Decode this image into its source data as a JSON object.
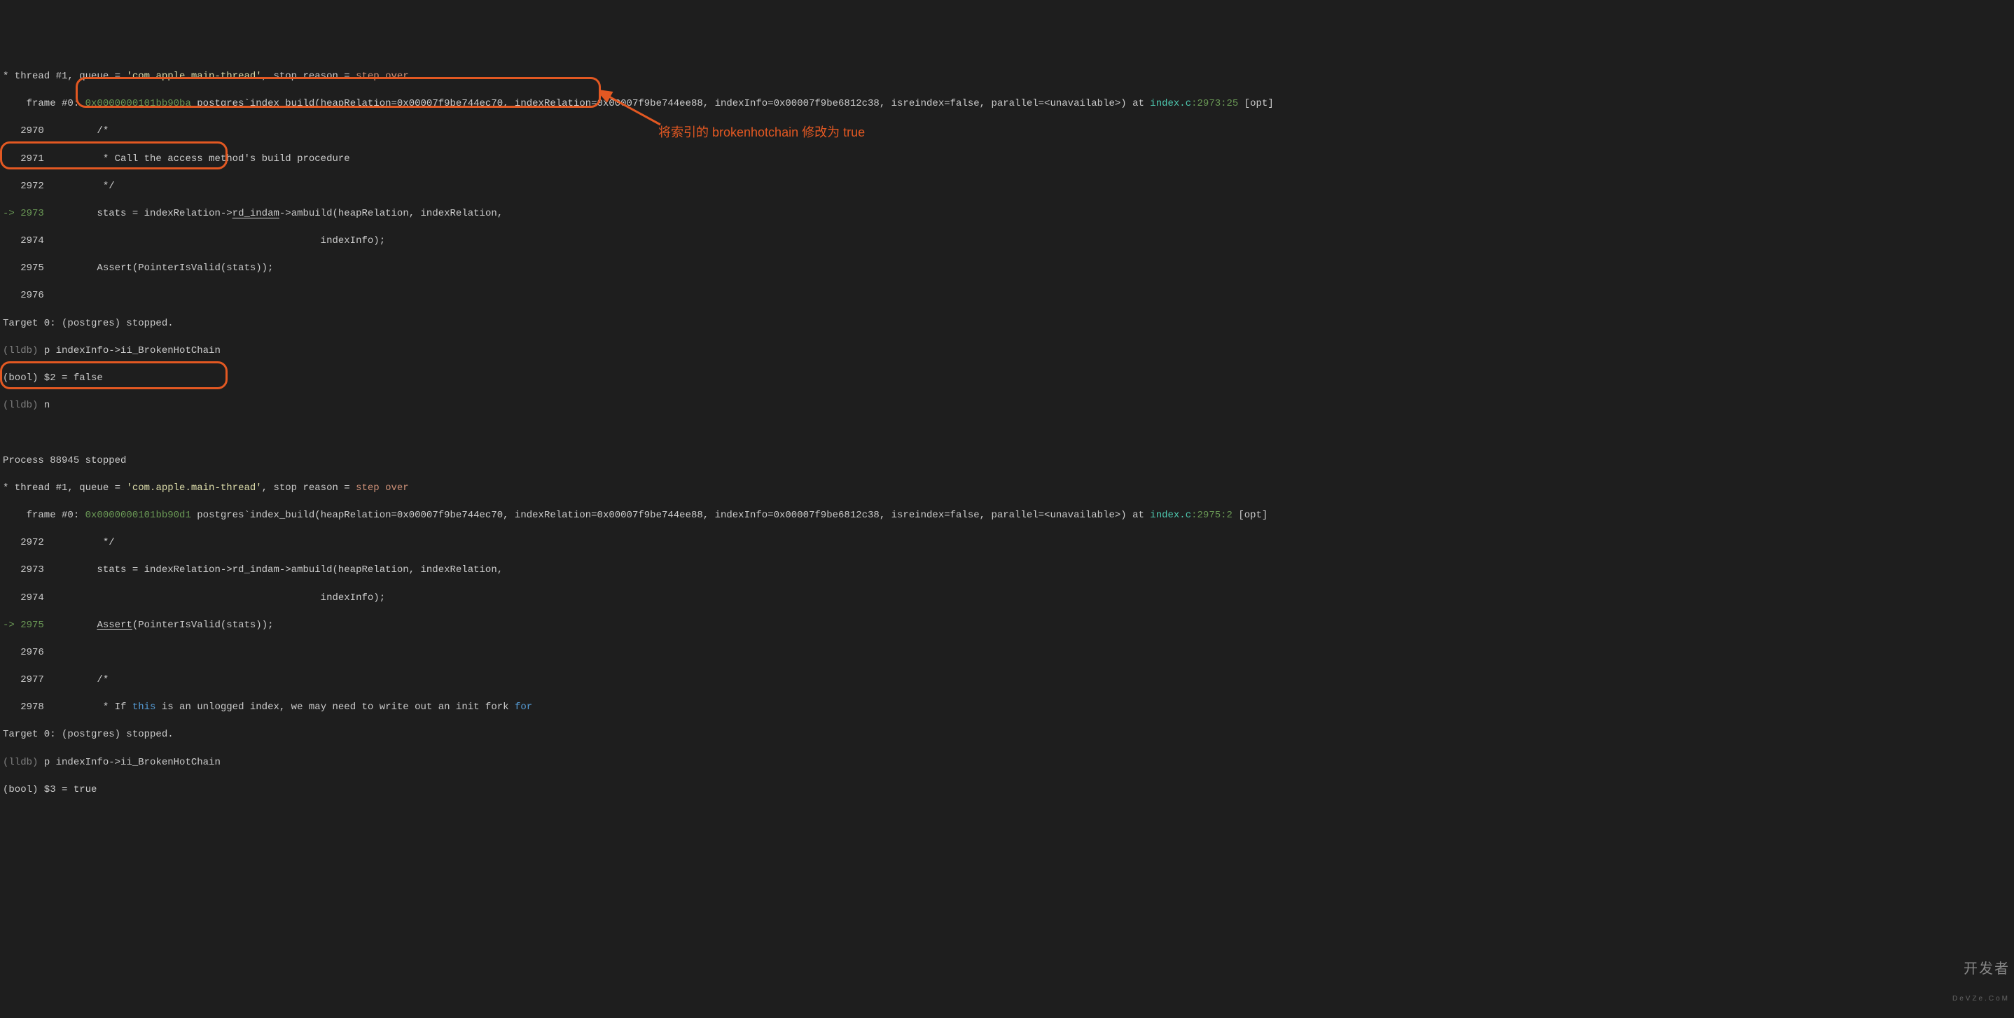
{
  "annotation_text": "将索引的 brokenhotchain 修改为 true",
  "watermark_top": "开发者",
  "watermark_bot": "DeVZe.CoM",
  "block1": {
    "thread_line_prefix": "* thread #1, queue = ",
    "thread_queue": "'com.apple.main-thread'",
    "thread_line_mid": ", stop reason = ",
    "stop_reason": "step over",
    "frame_prefix": "    frame #0: ",
    "frame_addr": "0x0000000101bb90ba",
    "frame_mid": " postgres`index_build(heapRelation=0x00007f9be744ec70, indexRelation=0x00007f9be744ee88, indexInfo=0x00007f9be6812c38, isreindex=false, parallel=<unavailable>) at ",
    "frame_file": "index.c",
    "frame_loc": ":2973:25",
    "opt": " [opt]",
    "l2970": "   2970         /*",
    "l2971": "   2971          * Call the access method's build procedure",
    "l2972": "   2972          */",
    "l2973_pre": "-> ",
    "l2973_num": "2973",
    "l2973_a": "         stats = indexRelation->",
    "l2973_b": "rd_indam",
    "l2973_c": "->ambuild(heapRelation, indexRelation,",
    "l2974": "   2974                                               indexInfo);",
    "l2975": "   2975         Assert(PointerIsValid(stats));",
    "l2976": "   2976",
    "target": "Target 0: (postgres) stopped.",
    "lldb_prompt": "(lldb)",
    "p_cmd": " p indexInfo->ii_BrokenHotChain",
    "result": "(bool) $2 = false",
    "n_cmd": " n"
  },
  "block2": {
    "process": "Process 88945 stopped",
    "thread_line_prefix": "* thread #1, queue = ",
    "thread_queue": "'com.apple.main-thread'",
    "thread_line_mid": ", stop reason = ",
    "stop_reason": "step over",
    "frame_prefix": "    frame #0: ",
    "frame_addr": "0x0000000101bb90d1",
    "frame_mid": " postgres`index_build(heapRelation=0x00007f9be744ec70, indexRelation=0x00007f9be744ee88, indexInfo=0x00007f9be6812c38, isreindex=false, parallel=<unavailable>) at ",
    "frame_file": "index.c",
    "frame_loc": ":2975:2",
    "opt": " [opt]",
    "l2972": "   2972          */",
    "l2973": "   2973         stats = indexRelation->rd_indam->ambuild(heapRelation, indexRelation,",
    "l2974": "   2974                                               indexInfo);",
    "l2975_pre": "-> ",
    "l2975_num": "2975",
    "l2975_a": "         ",
    "l2975_b": "Assert",
    "l2975_c": "(PointerIsValid(stats));",
    "l2976": "   2976",
    "l2977": "   2977         /*",
    "l2978_a": "   2978          * If ",
    "l2978_this": "this",
    "l2978_b": " is an unlogged index, we may need to write out an init fork ",
    "l2978_for": "for",
    "target": "Target 0: (postgres) stopped.",
    "lldb_prompt": "(lldb)",
    "p_cmd": " p indexInfo->ii_BrokenHotChain",
    "result": "(bool) $3 = true"
  }
}
